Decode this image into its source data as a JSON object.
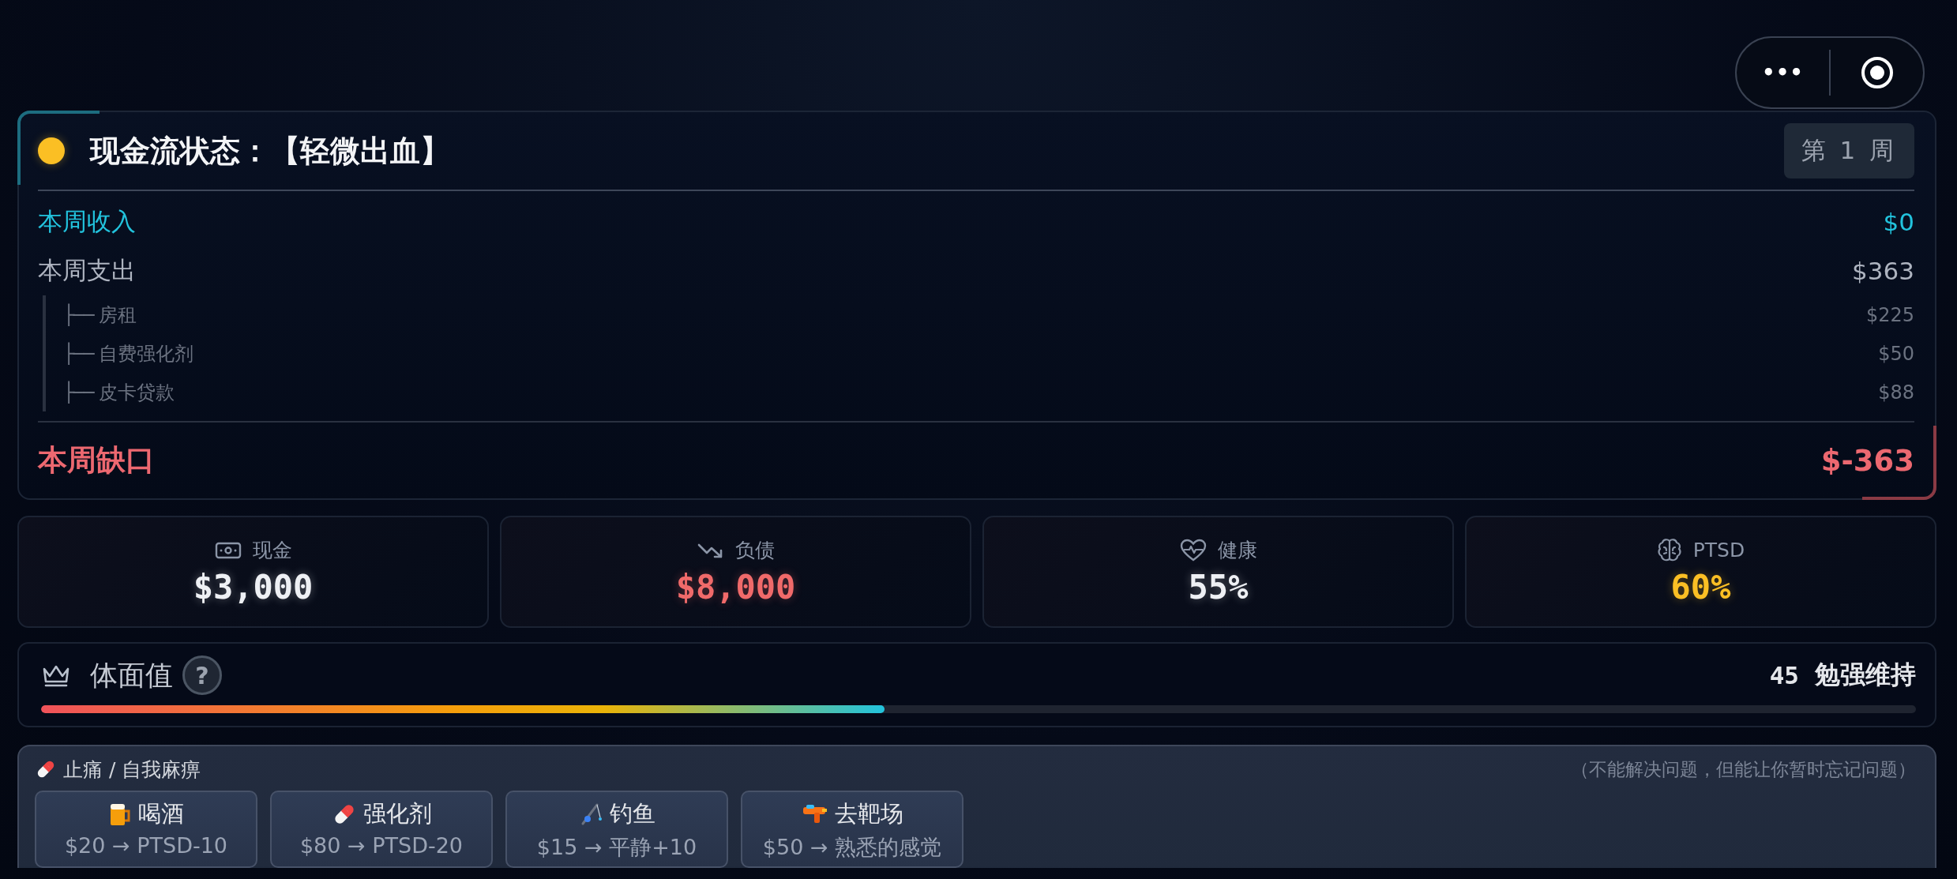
{
  "capsule": {
    "more_label": "•••"
  },
  "cash_flow": {
    "title": "现金流状态：【轻微出血】",
    "status_dot": {
      "color": "#fbbf24"
    },
    "week_badge": "第 1 周",
    "rows": [
      {
        "kind": "income",
        "label": "本周收入",
        "value": "$0"
      },
      {
        "kind": "expense",
        "label": "本周支出",
        "value": "$363",
        "children": [
          {
            "branch": "├──",
            "label": "房租",
            "value": "$225"
          },
          {
            "branch": "├──",
            "label": "自费强化剂",
            "value": "$50"
          },
          {
            "branch": "├──",
            "label": "皮卡贷款",
            "value": "$88"
          }
        ]
      }
    ],
    "deficit": {
      "label": "本周缺口",
      "value": "$-363"
    }
  },
  "stats": [
    {
      "label": "现金",
      "value": "$3,000",
      "color": "#eef0f4"
    },
    {
      "label": "负债",
      "value": "$8,000",
      "color": "#f06a6a"
    },
    {
      "label": "健康",
      "value": "55%",
      "color": "#eef0f4"
    },
    {
      "label": "PTSD",
      "value": "60%",
      "color": "#fbbf24"
    }
  ],
  "dignity": {
    "title": "体面值",
    "help": "?",
    "score": "45",
    "status": "勉强维持",
    "level": 0.45
  },
  "relief": {
    "title": "止痛 / 自我麻痹",
    "note": "（不能解决问题，但能让你暂时忘记问题）",
    "actions": [
      {
        "label": "喝酒",
        "effect": "$20 → PTSD-10"
      },
      {
        "label": "强化剂",
        "effect": "$80 → PTSD-20"
      },
      {
        "label": "钓鱼",
        "effect": "$15 → 平静+10"
      },
      {
        "label": "去靶场",
        "effect": "$50 → 熟悉的感觉"
      }
    ]
  }
}
